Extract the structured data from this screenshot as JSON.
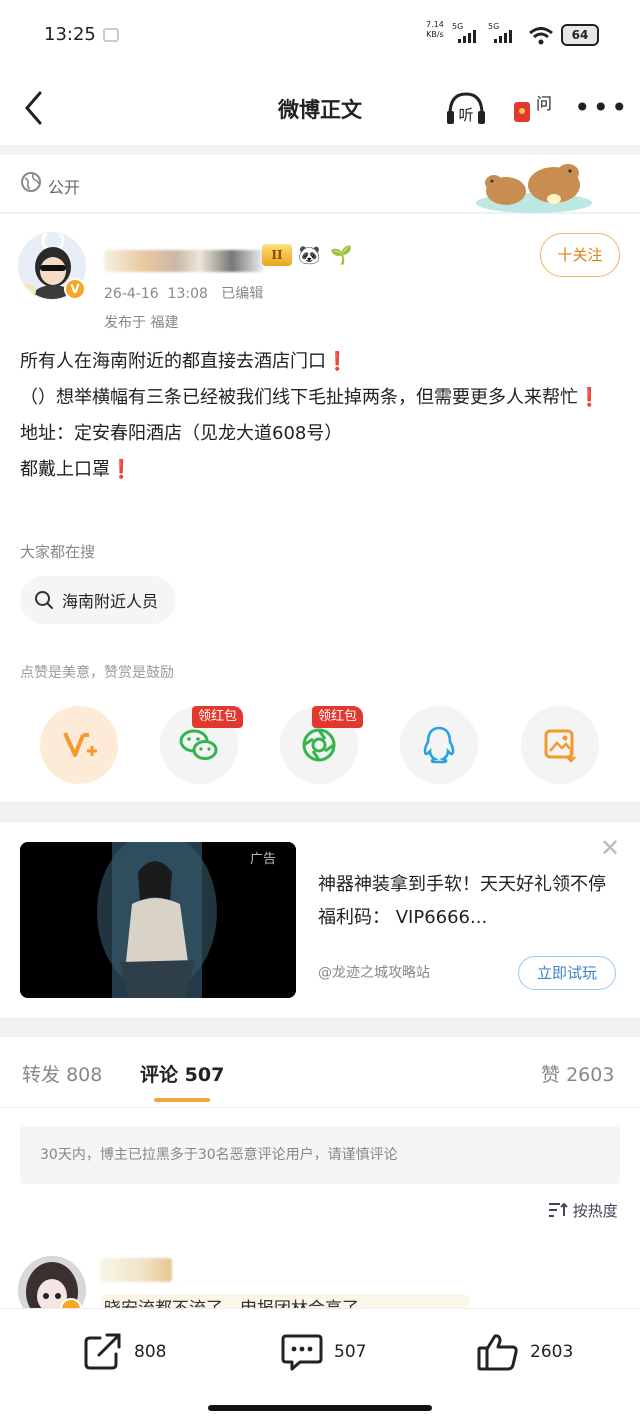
{
  "status_bar": {
    "time": "13:25",
    "net_speed": "7.14",
    "net_unit": "KB/s",
    "sig1": "5G",
    "sig2": "5G",
    "battery": "64"
  },
  "nav": {
    "title": "微博正文",
    "ask_label": "问"
  },
  "post": {
    "visibility": "公开",
    "level": "II",
    "date": "26-4-16",
    "time": "13:08",
    "edited": "已编辑",
    "location": "发布于  福建",
    "follow": "十关注",
    "avatar_badge": "V",
    "lines": [
      "所有人在海南附近的都直接去酒店门口",
      "（）想举横幅有三条已经被我们线下毛扯掉两条，但需要更多人来帮忙",
      "地址：定安春阳酒店（见龙大道608号）",
      "都戴上口罩"
    ],
    "hot_search_label": "大家都在搜",
    "hot_search_item": "海南附近人员",
    "like_note": "点赞是美意，赞赏是鼓励",
    "red_packet": "领红包"
  },
  "ad": {
    "tag": "广告",
    "text": "神器神装拿到手软！天天好礼领不停  福利码：  VIP6666...",
    "source": "@龙迹之城攻略站",
    "button": "立即试玩"
  },
  "tabs": {
    "repost_label": "转发",
    "repost_count": "808",
    "comment_label": "评论",
    "comment_count": "507",
    "like_label": "赞",
    "like_count": "2603"
  },
  "notice": "30天内，博主已拉黑多于30名恶意评论用户，请谨慎评论",
  "sort": "按热度",
  "comment": {
    "text": "晓安流都不流了，申报团林会高了"
  },
  "bottom_bar": {
    "repost": "808",
    "comment": "507",
    "like": "2603"
  },
  "colors": {
    "accent_orange": "#e07d14",
    "red": "#e2382d",
    "link_blue": "#3b84c9"
  }
}
